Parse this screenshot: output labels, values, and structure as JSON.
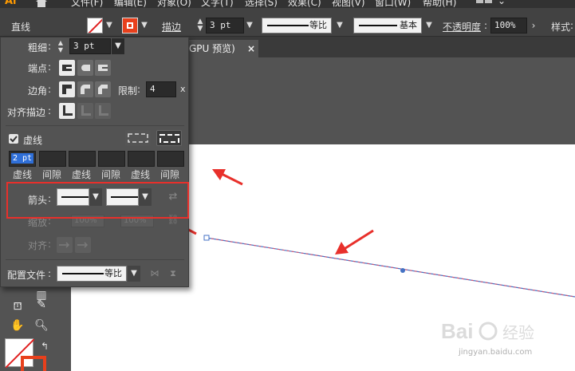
{
  "menubar": {
    "app_logo": "Ai",
    "items": [
      "文件(F)",
      "编辑(E)",
      "对象(O)",
      "文字(T)",
      "选择(S)",
      "效果(C)",
      "视图(V)",
      "窗口(W)",
      "帮助(H)"
    ]
  },
  "control_bar": {
    "object_type": "直线",
    "stroke_label": "描边",
    "stroke_weight": "3 pt",
    "stroke_profile_label": "等比",
    "brush_label": "基本",
    "opacity_label": "不透明度",
    "opacity_value": "100%",
    "style_label": "样式"
  },
  "document_tab": {
    "title": "GPU 预览)",
    "close": "×"
  },
  "stroke_panel": {
    "weight_label": "粗细",
    "weight_value": "3 pt",
    "cap_label": "端点",
    "corner_label": "边角",
    "limit_label": "限制",
    "limit_value": "4",
    "limit_unit": "x",
    "align_label": "对齐描边",
    "dashed_label": "虚线",
    "dashed_checked": true,
    "dash_values": [
      "2 pt",
      "",
      "",
      "",
      "",
      ""
    ],
    "dash_headers": [
      "虚线",
      "间隙",
      "虚线",
      "间隙",
      "虚线",
      "间隙"
    ],
    "arrowhead_label": "箭头",
    "scale_label": "缩放",
    "scale_values": [
      "100%",
      "100%"
    ],
    "align_arrow_label": "对齐",
    "profile_label": "配置文件",
    "profile_value": "等比"
  },
  "colors": {
    "highlight": "#e8302b",
    "path": "#4472c4",
    "stroke_swatch": "#e8401c",
    "app_logo": "#ff9a00"
  },
  "watermark": {
    "brand": "Bai",
    "brand2": "经验",
    "url": "jingyan.baidu.com"
  }
}
